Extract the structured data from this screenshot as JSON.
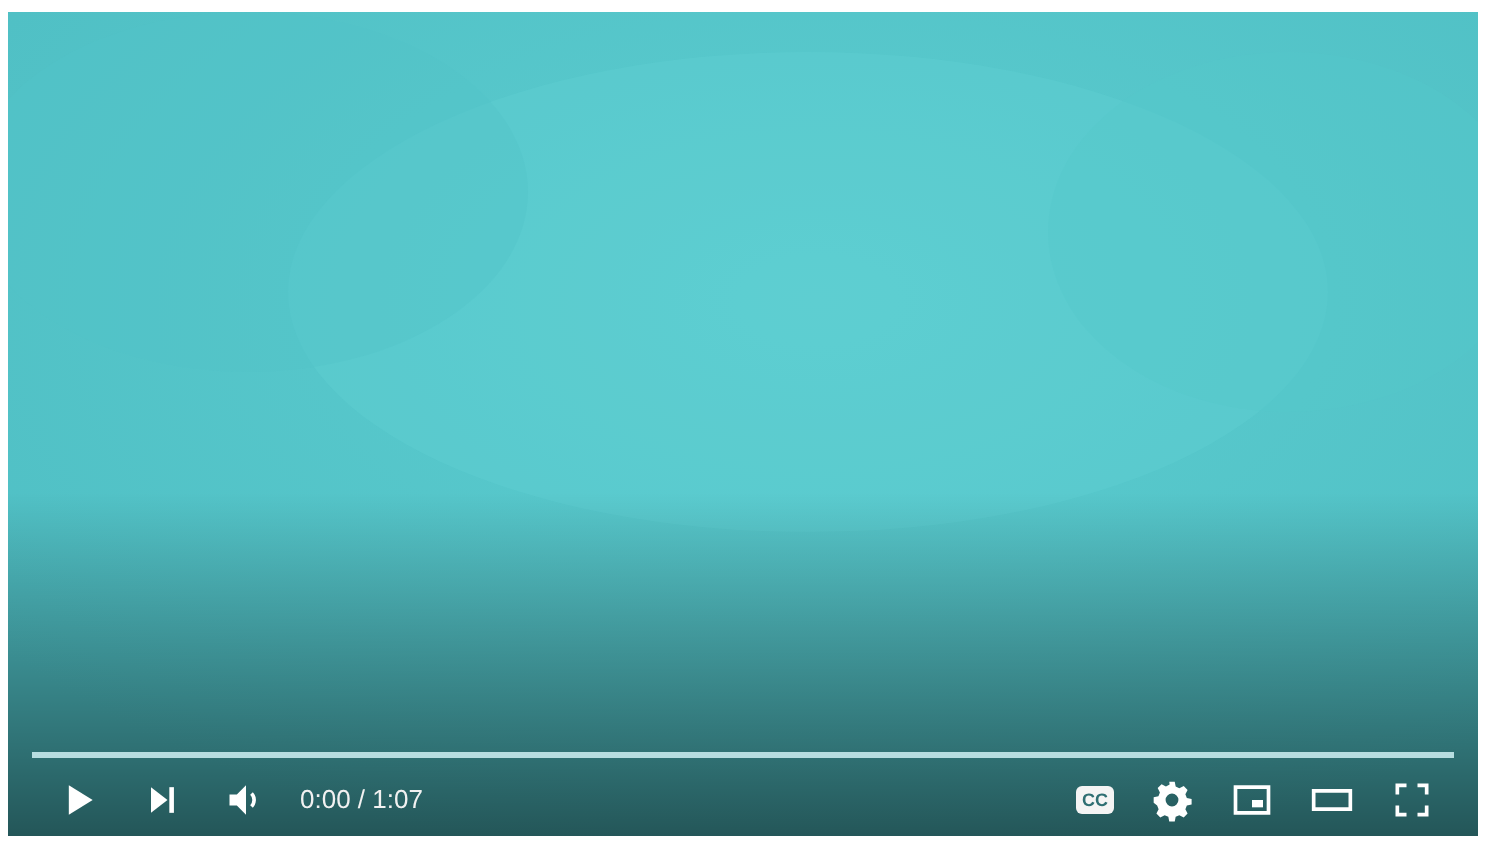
{
  "controls": {
    "time": "0:00 / 1:07",
    "captions_label": "CC"
  }
}
